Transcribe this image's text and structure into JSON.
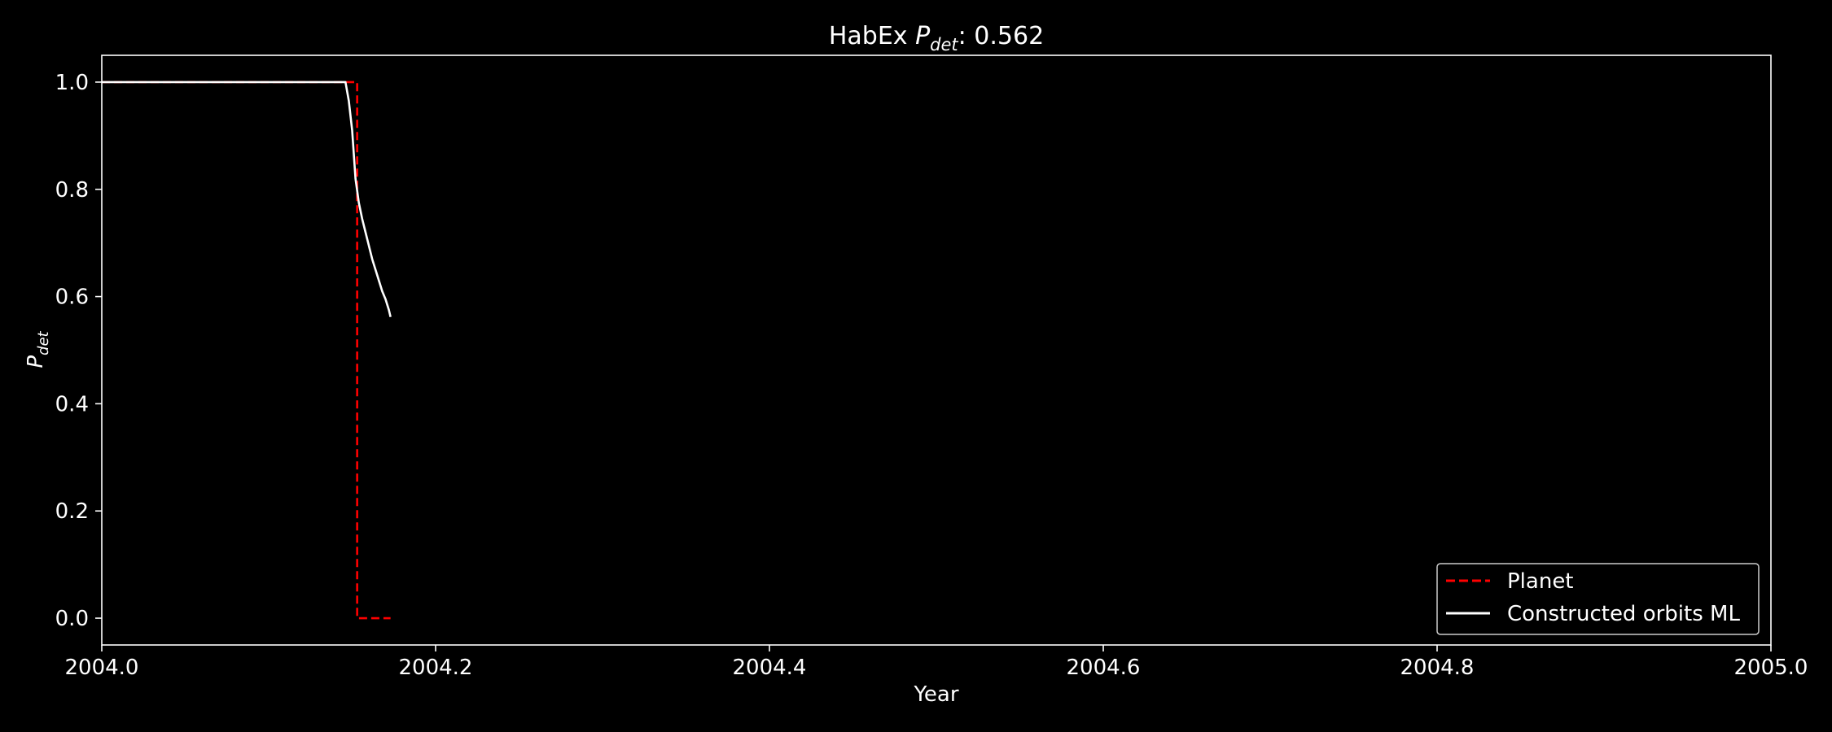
{
  "chart_data": {
    "type": "line",
    "title": {
      "prefix": "HabEx ",
      "symbol": "P",
      "subscript": "det",
      "suffix": ": 0.562"
    },
    "xlabel": "Year",
    "ylabel": {
      "symbol": "P",
      "subscript": "det"
    },
    "xlim": [
      2004.0,
      2005.0
    ],
    "ylim": [
      -0.05,
      1.05
    ],
    "xticks": [
      {
        "value": 2004.0,
        "label": "2004.0"
      },
      {
        "value": 2004.2,
        "label": "2004.2"
      },
      {
        "value": 2004.4,
        "label": "2004.4"
      },
      {
        "value": 2004.6,
        "label": "2004.6"
      },
      {
        "value": 2004.8,
        "label": "2004.8"
      },
      {
        "value": 2005.0,
        "label": "2005.0"
      }
    ],
    "yticks": [
      {
        "value": 0.0,
        "label": "0.0"
      },
      {
        "value": 0.2,
        "label": "0.2"
      },
      {
        "value": 0.4,
        "label": "0.4"
      },
      {
        "value": 0.6,
        "label": "0.6"
      },
      {
        "value": 0.8,
        "label": "0.8"
      },
      {
        "value": 1.0,
        "label": "1.0"
      }
    ],
    "grid": false,
    "legend_position": "lower-right",
    "colors": {
      "background": "#000000",
      "foreground": "#ffffff"
    },
    "series": [
      {
        "name": "Planet",
        "color": "#ff0000",
        "style": "dashed",
        "x": [
          2004.0,
          2004.151,
          2004.151,
          2004.153,
          2004.153,
          2004.173
        ],
        "y": [
          1.0,
          1.0,
          1.0,
          1.0,
          0.0,
          0.0
        ]
      },
      {
        "name": "Constructed orbits ML",
        "color": "#ffffff",
        "style": "solid",
        "x": [
          2004.0,
          2004.146,
          2004.148,
          2004.15,
          2004.152,
          2004.154,
          2004.156,
          2004.158,
          2004.16,
          2004.162,
          2004.164,
          2004.166,
          2004.168,
          2004.17,
          2004.172,
          2004.173
        ],
        "y": [
          1.0,
          1.0,
          0.965,
          0.91,
          0.82,
          0.775,
          0.745,
          0.72,
          0.695,
          0.67,
          0.65,
          0.63,
          0.61,
          0.595,
          0.575,
          0.562
        ]
      }
    ]
  }
}
